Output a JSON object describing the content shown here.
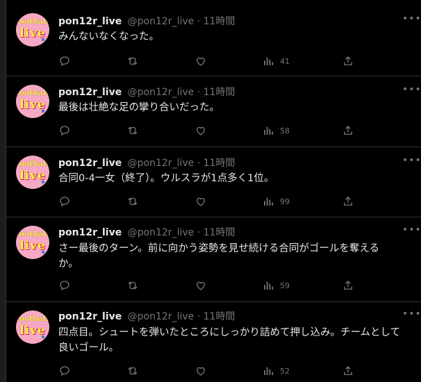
{
  "tweets": [
    {
      "name": "pon12r_live",
      "handle": "@pon12r_live",
      "sep": "·",
      "time": "11時間",
      "text": "みんないなくなった。",
      "views": "41"
    },
    {
      "name": "pon12r_live",
      "handle": "@pon12r_live",
      "sep": "·",
      "time": "11時間",
      "text": "最後は壮絶な足の攣り合いだった。",
      "views": "58"
    },
    {
      "name": "pon12r_live",
      "handle": "@pon12r_live",
      "sep": "·",
      "time": "11時間",
      "text": "合同0-4一女（終了）。ウルスラが1点多く1位。",
      "views": "99"
    },
    {
      "name": "pon12r_live",
      "handle": "@pon12r_live",
      "sep": "·",
      "time": "11時間",
      "text": "さー最後のターン。前に向かう姿勢を見せ続ける合同がゴールを奪えるか。",
      "views": "59"
    },
    {
      "name": "pon12r_live",
      "handle": "@pon12r_live",
      "sep": "·",
      "time": "11時間",
      "text": "四点目。シュートを弾いたところにしっかり詰めて押し込み。チームとして良いゴール。",
      "views": "52"
    }
  ],
  "avatar": {
    "line1": "football",
    "line2": "live",
    "bg": "#f7a8c4",
    "text_color": "#f8ff3a"
  },
  "more_icon": "•••",
  "icons": [
    "reply-icon",
    "retweet-icon",
    "like-icon",
    "views-icon",
    "share-icon"
  ],
  "colors": {
    "background": "#000000",
    "text": "#e7e9ea",
    "muted": "#71767b",
    "divider": "#2f3336"
  }
}
